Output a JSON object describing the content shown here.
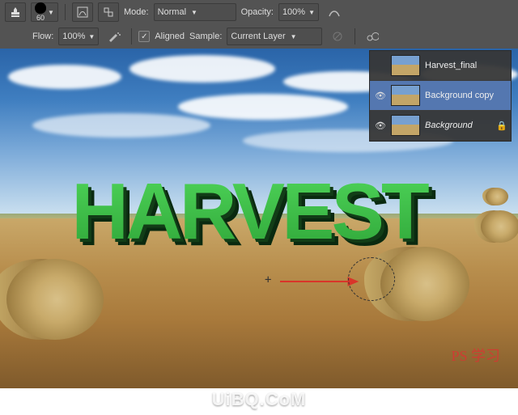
{
  "toolbar1": {
    "brush_size": "60",
    "mode_label": "Mode:",
    "mode_value": "Normal",
    "opacity_label": "Opacity:",
    "opacity_value": "100%"
  },
  "toolbar2": {
    "flow_label": "Flow:",
    "flow_value": "100%",
    "aligned_label": "Aligned",
    "sample_label": "Sample:",
    "sample_value": "Current Layer"
  },
  "layers": {
    "item0": {
      "name": "Harvest_final"
    },
    "item1": {
      "name": "Background copy"
    },
    "item2": {
      "name": "Background"
    }
  },
  "canvas_text": "HARVEST",
  "watermark": "UiBQ.CoM",
  "watermark2": "PS 学习"
}
